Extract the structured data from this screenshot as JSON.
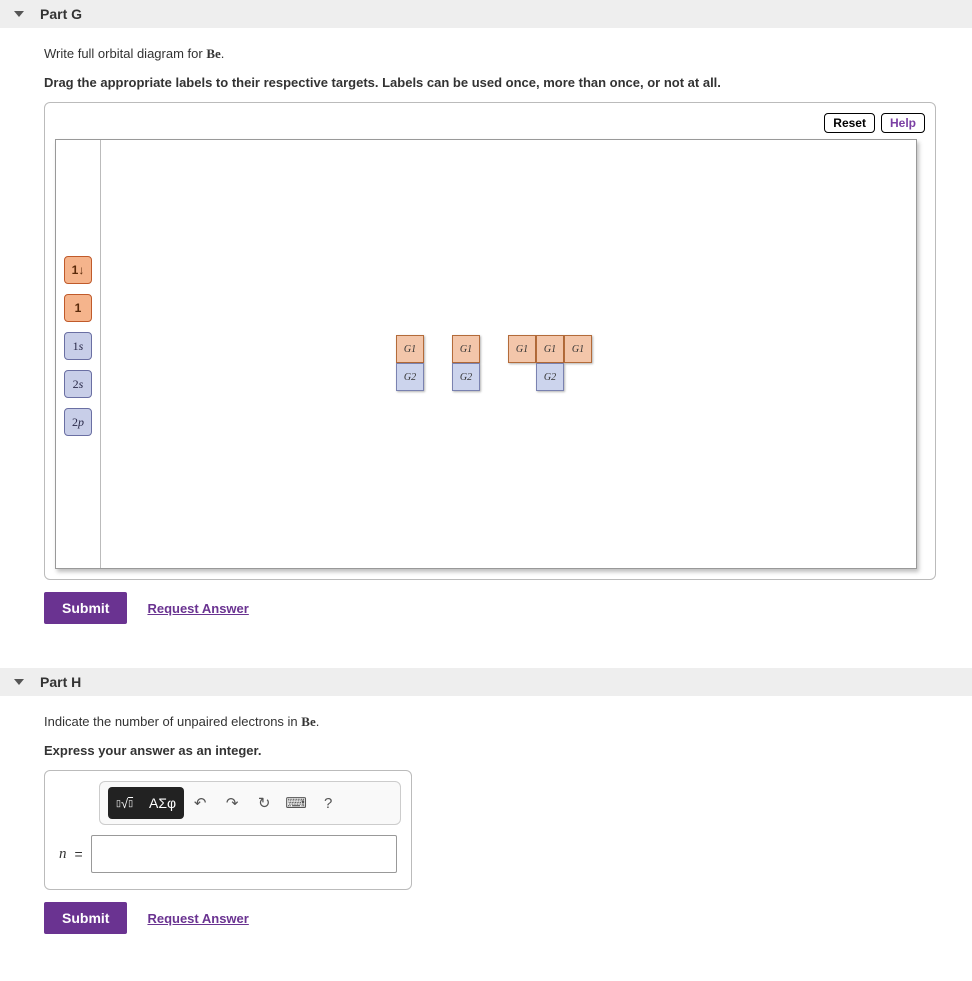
{
  "partG": {
    "title": "Part G",
    "prompt_pre": "Write full orbital diagram for ",
    "prompt_elem": "Be",
    "prompt_post": ".",
    "instruction": "Drag the appropriate labels to their respective targets. Labels can be used once, more than once, or not at all.",
    "reset": "Reset",
    "help": "Help",
    "palette": {
      "updown": "1↓",
      "up": "1",
      "s1": "1s",
      "s2": "2s",
      "p2": "2p"
    },
    "targets": {
      "g1": "G1",
      "g2": "G2"
    },
    "submit": "Submit",
    "request": "Request Answer"
  },
  "partH": {
    "title": "Part H",
    "prompt_pre": "Indicate the number of unpaired electrons in ",
    "prompt_elem": "Be",
    "prompt_post": ".",
    "instruction": "Express your answer as an integer.",
    "toolbar": {
      "templates": "▫√▫",
      "greek": "ΑΣφ",
      "undo": "↶",
      "redo": "↷",
      "reset": "↻",
      "keyboard": "⌨",
      "helpq": "?"
    },
    "var": "n",
    "eq": "=",
    "value": "",
    "submit": "Submit",
    "request": "Request Answer"
  }
}
